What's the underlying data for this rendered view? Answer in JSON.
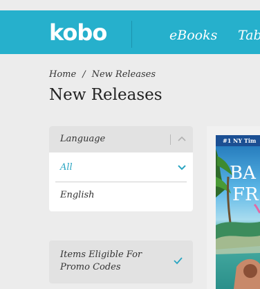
{
  "header": {
    "logo": "kobo",
    "nav": [
      {
        "label": "eBooks"
      },
      {
        "label": "Tab"
      }
    ],
    "background": "#26b0cc"
  },
  "breadcrumb": {
    "items": [
      "Home",
      "New Releases"
    ],
    "separator": "/"
  },
  "page": {
    "title": "New Releases"
  },
  "filters": {
    "language": {
      "label": "Language",
      "options": [
        {
          "label": "All",
          "selected": true
        },
        {
          "label": "English",
          "selected": false
        }
      ]
    },
    "promo": {
      "label": "Items Eligible For Promo Codes",
      "checked": true
    }
  },
  "book": {
    "cover_text": {
      "top": "#1 NY Tim",
      "title_line1": "BA",
      "title_line2": "FR"
    }
  },
  "colors": {
    "accent": "#26b0cc",
    "link": "#2aa5c2"
  }
}
